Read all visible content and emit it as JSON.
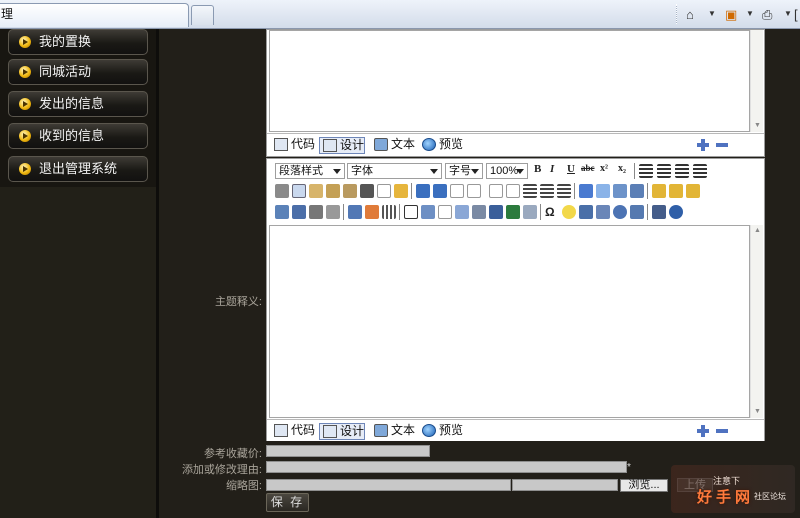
{
  "browser": {
    "tab_title": "理",
    "tools": [
      "home-icon",
      "feeds-icon",
      "print-icon",
      "page-icon"
    ]
  },
  "sidebar": {
    "items": [
      {
        "label": "我的置换"
      },
      {
        "label": "同城活动"
      },
      {
        "label": "发出的信息"
      },
      {
        "label": "收到的信息"
      },
      {
        "label": "退出管理系统"
      }
    ]
  },
  "editor_modes": {
    "code": "代码",
    "design": "设计",
    "text": "文本",
    "preview": "预览"
  },
  "toolbar": {
    "paragraph_style": "段落样式",
    "font_family": "字体",
    "font_size": "字号",
    "zoom": "100%",
    "bold": "B",
    "italic": "I",
    "underline": "U",
    "strike": "abc",
    "superscript": "x²",
    "subscript": "x₂"
  },
  "form": {
    "theme_label": "主题释义:",
    "reference_price_label": "参考收藏价:",
    "reason_label": "添加或修改理由:",
    "thumbnail_label": "缩略图:",
    "required_mark": "*",
    "browse_button": "浏览...",
    "upload_button": "上传",
    "save_button": "保 存"
  },
  "watermark": {
    "top": "注意下",
    "main": "好手网",
    "sub": "社区论坛"
  }
}
